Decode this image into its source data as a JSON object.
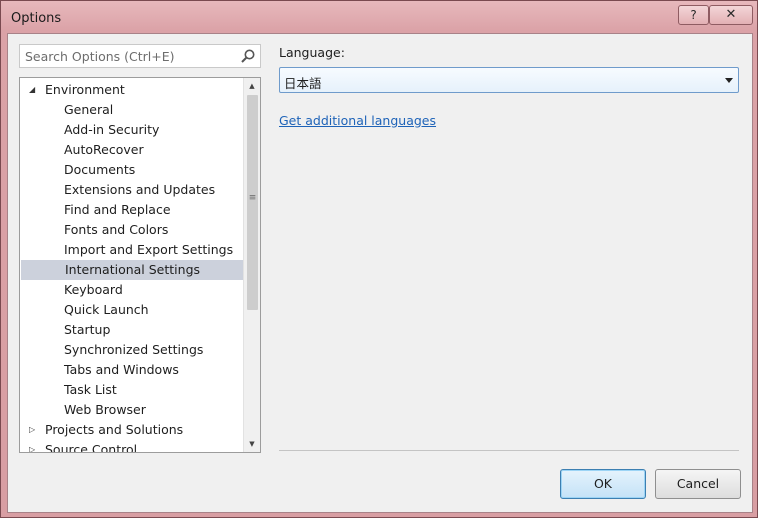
{
  "window": {
    "title": "Options",
    "help_label": "?",
    "close_label": "✕"
  },
  "search": {
    "placeholder": "Search Options (Ctrl+E)"
  },
  "tree": {
    "items": [
      {
        "label": "Environment",
        "expanded": true,
        "level": 0
      },
      {
        "label": "General",
        "level": 1
      },
      {
        "label": "Add-in Security",
        "level": 1
      },
      {
        "label": "AutoRecover",
        "level": 1
      },
      {
        "label": "Documents",
        "level": 1
      },
      {
        "label": "Extensions and Updates",
        "level": 1
      },
      {
        "label": "Find and Replace",
        "level": 1
      },
      {
        "label": "Fonts and Colors",
        "level": 1
      },
      {
        "label": "Import and Export Settings",
        "level": 1
      },
      {
        "label": "International Settings",
        "level": 1,
        "selected": true
      },
      {
        "label": "Keyboard",
        "level": 1
      },
      {
        "label": "Quick Launch",
        "level": 1
      },
      {
        "label": "Startup",
        "level": 1
      },
      {
        "label": "Synchronized Settings",
        "level": 1
      },
      {
        "label": "Tabs and Windows",
        "level": 1
      },
      {
        "label": "Task List",
        "level": 1
      },
      {
        "label": "Web Browser",
        "level": 1
      },
      {
        "label": "Projects and Solutions",
        "expanded": false,
        "level": 0
      },
      {
        "label": "Source Control",
        "expanded": false,
        "level": 0
      }
    ]
  },
  "settings": {
    "language_label": "Language:",
    "language_value": "日本語",
    "additional_link": "Get additional languages"
  },
  "buttons": {
    "ok": "OK",
    "cancel": "Cancel"
  },
  "colors": {
    "selected_row": "#ccd1dc",
    "link": "#1e63b8",
    "title_bar": "#dba2a7"
  }
}
